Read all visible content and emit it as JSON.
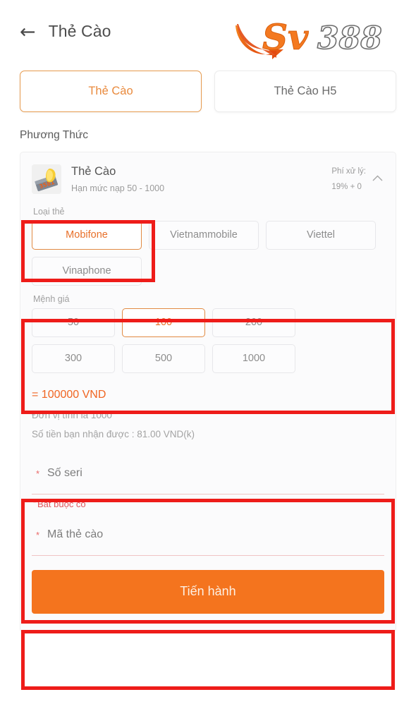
{
  "header": {
    "back_icon": "back-arrow-icon",
    "title": "Thẻ Cào",
    "logo": {
      "brand_primary": "SV",
      "brand_secondary": "388",
      "icon": "sv388-logo"
    }
  },
  "tabs": [
    {
      "label": "Thẻ Cào",
      "active": true
    },
    {
      "label": "Thẻ Cào H5",
      "active": false
    }
  ],
  "section": {
    "label": "Phương Thức"
  },
  "method": {
    "icon": "scratch-card-icon",
    "name": "Thẻ Cào",
    "limit": "Hạn mức nạp 50 - 1000",
    "fee_label": "Phí xử lý:",
    "fee_value": "19% + 0",
    "collapse_icon": "chevron-up-icon"
  },
  "card_type": {
    "label": "Loại thẻ",
    "options": [
      {
        "label": "Mobifone",
        "selected": true
      },
      {
        "label": "Vietnammobile",
        "selected": false
      },
      {
        "label": "Viettel",
        "selected": false
      },
      {
        "label": "Vinaphone",
        "selected": false
      }
    ]
  },
  "denomination": {
    "label": "Mệnh giá",
    "options": [
      {
        "label": "50",
        "selected": false
      },
      {
        "label": "100",
        "selected": true
      },
      {
        "label": "200",
        "selected": false
      },
      {
        "label": "300",
        "selected": false
      },
      {
        "label": "500",
        "selected": false
      },
      {
        "label": "1000",
        "selected": false
      }
    ]
  },
  "amount_info": {
    "equals": "= 100000 VND",
    "unit_note": "Đơn vị tính là 1000",
    "receive_note": "Số tiền bạn nhận được : 81.00 VND(k)"
  },
  "form": {
    "serial": {
      "placeholder": "Số seri",
      "value": "",
      "required_mark": "*",
      "error": "Bắt buộc có"
    },
    "code": {
      "placeholder": "Mã thẻ cào",
      "value": "",
      "required_mark": "*"
    }
  },
  "submit": {
    "label": "Tiến hành"
  },
  "colors": {
    "accent_orange": "#f4741e",
    "selected_text": "#e8702a",
    "selected_border": "#e18a43",
    "annotation_red": "#ee1c19",
    "error_red": "#e0555a",
    "page_bg": "#ffffff",
    "card_bg": "#fbfbfc"
  }
}
